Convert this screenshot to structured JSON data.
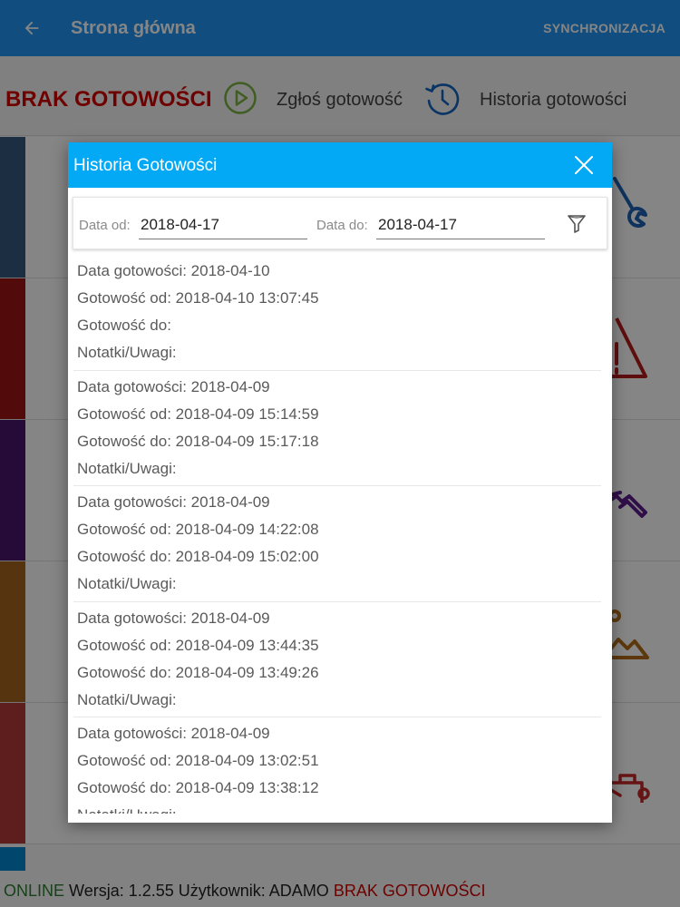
{
  "appbar": {
    "title": "Strona główna",
    "sync_label": "SYNCHRONIZACJA",
    "back_icon": "arrow-left-icon"
  },
  "status": {
    "state": "BRAK GOTOWOŚCI",
    "report_label": "Zgłoś gotowość",
    "history_label": "Historia gotowości"
  },
  "tiles": [
    {
      "color": "#37587f",
      "icon": "wrench-icon",
      "icon_color": "#1e63b5"
    },
    {
      "color": "#a01515",
      "icon": "warning-icon",
      "icon_color": "#b71c1c"
    },
    {
      "color": "#4a166e",
      "icon": "hammer-icon",
      "icon_color": "#5c1c8c"
    },
    {
      "color": "#a5651d",
      "icon": "landscape-icon",
      "icon_color": "#b36b1a"
    },
    {
      "color": "#b63a3a",
      "icon": "forklift-icon",
      "icon_color": "#c62828"
    }
  ],
  "footer": {
    "online": "ONLINE",
    "version_text": "Wersja: 1.2.55 Użytkownik: ADAMO",
    "state": "BRAK GOTOWOŚCI"
  },
  "dialog": {
    "title": "Historia Gotowości",
    "filter": {
      "date_from_label": "Data od:",
      "date_from_value": "2018-04-17",
      "date_to_label": "Data do:",
      "date_to_value": "2018-04-17"
    },
    "entries": [
      {
        "date": "Data gotowości: 2018-04-10",
        "from": "Gotowość od: 2018-04-10 13:07:45",
        "to": "Gotowość do:",
        "notes": "Notatki/Uwagi:"
      },
      {
        "date": "Data gotowości: 2018-04-09",
        "from": "Gotowość od: 2018-04-09 15:14:59",
        "to": "Gotowość do: 2018-04-09 15:17:18",
        "notes": "Notatki/Uwagi:"
      },
      {
        "date": "Data gotowości: 2018-04-09",
        "from": "Gotowość od: 2018-04-09 14:22:08",
        "to": "Gotowość do: 2018-04-09 15:02:00",
        "notes": "Notatki/Uwagi:"
      },
      {
        "date": "Data gotowości: 2018-04-09",
        "from": "Gotowość od: 2018-04-09 13:44:35",
        "to": "Gotowość do: 2018-04-09 13:49:26",
        "notes": "Notatki/Uwagi:"
      },
      {
        "date": "Data gotowości: 2018-04-09",
        "from": "Gotowość od: 2018-04-09 13:02:51",
        "to": "Gotowość do: 2018-04-09 13:38:12",
        "notes": "Notatki/Uwagi:"
      }
    ]
  }
}
